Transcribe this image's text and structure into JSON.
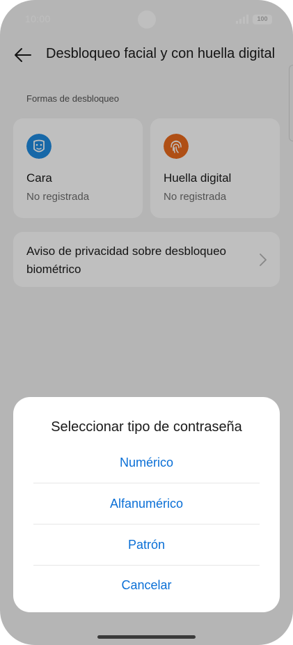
{
  "status_bar": {
    "time": "10:00",
    "battery": "100",
    "signal_icon": "signal-bars-icon"
  },
  "header": {
    "back_icon": "arrow-left-icon",
    "title": "Desbloqueo facial y con huella digital"
  },
  "section": {
    "label": "Formas de desbloqueo"
  },
  "methods": [
    {
      "title": "Cara",
      "status": "No registrada",
      "icon": "face-icon",
      "color": "#1f8be0"
    },
    {
      "title": "Huella digital",
      "status": "No registrada",
      "icon": "fingerprint-icon",
      "color": "#ea6a1c"
    }
  ],
  "privacy": {
    "label": "Aviso de privacidad sobre desbloqueo biométrico"
  },
  "dialog": {
    "title": "Seleccionar tipo de contraseña",
    "options": [
      "Numérico",
      "Alfanumérico",
      "Patrón"
    ],
    "cancel": "Cancelar"
  },
  "colors": {
    "accent": "#0a6fd6",
    "background": "#f2f2f2"
  }
}
